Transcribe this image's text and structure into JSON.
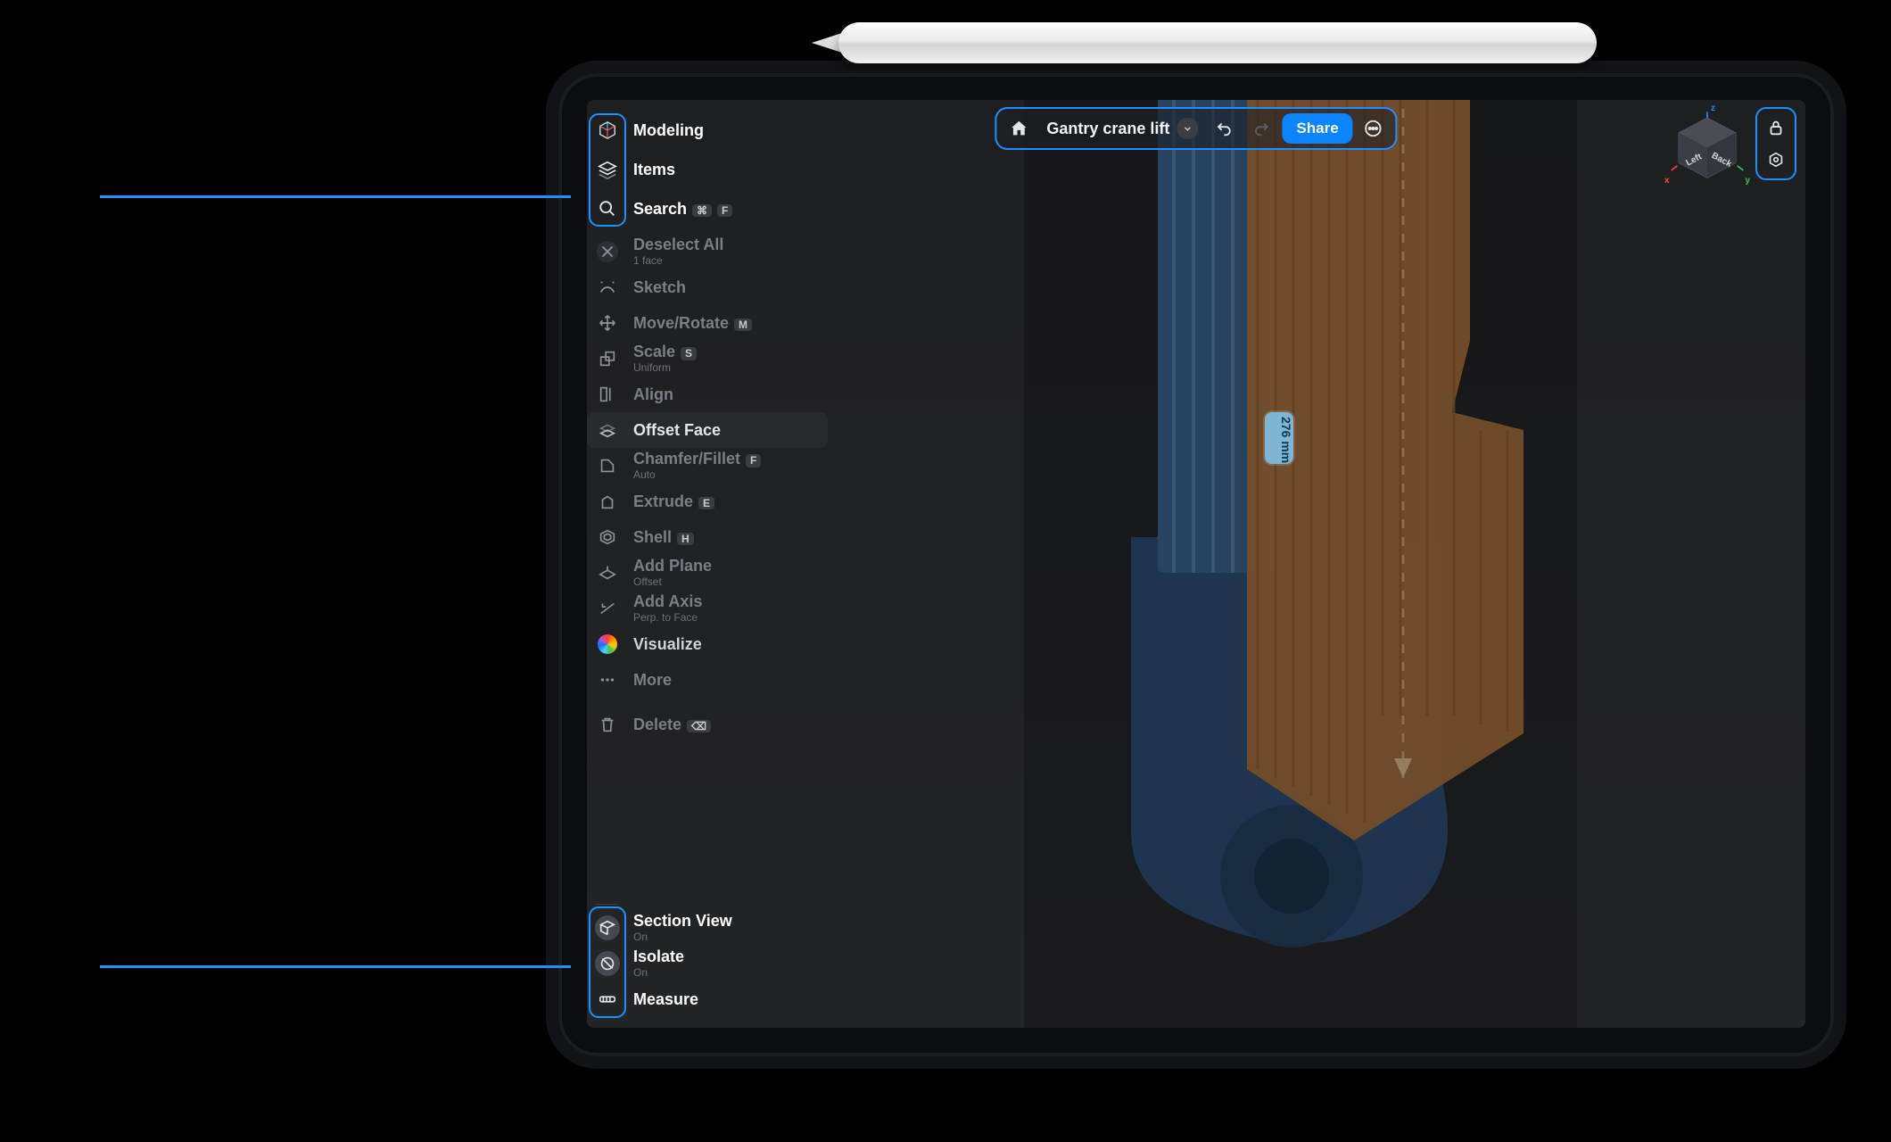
{
  "header": {
    "doc_title": "Gantry crane lift",
    "share_label": "Share"
  },
  "sidebar_top": {
    "modeling": "Modeling",
    "items": "Items",
    "search": "Search",
    "search_k1": "⌘",
    "search_k2": "F"
  },
  "tools": {
    "deselect": {
      "label": "Deselect All",
      "sub": "1 face"
    },
    "sketch": {
      "label": "Sketch"
    },
    "move": {
      "label": "Move/Rotate",
      "k": "M"
    },
    "scale": {
      "label": "Scale",
      "k": "S",
      "sub": "Uniform"
    },
    "align": {
      "label": "Align"
    },
    "offset": {
      "label": "Offset Face"
    },
    "chamfer": {
      "label": "Chamfer/Fillet",
      "k": "F",
      "sub": "Auto"
    },
    "extrude": {
      "label": "Extrude",
      "k": "E"
    },
    "shell": {
      "label": "Shell",
      "k": "H"
    },
    "addplane": {
      "label": "Add Plane",
      "sub": "Offset"
    },
    "addaxis": {
      "label": "Add Axis",
      "sub": "Perp. to Face"
    },
    "visualize": {
      "label": "Visualize"
    },
    "more": {
      "label": "More"
    },
    "delete": {
      "label": "Delete",
      "k": "⌫"
    }
  },
  "sidebar_bottom": {
    "section": {
      "label": "Section View",
      "sub": "On"
    },
    "isolate": {
      "label": "Isolate",
      "sub": "On"
    },
    "measure": {
      "label": "Measure"
    }
  },
  "navcube": {
    "left": "Left",
    "back": "Back",
    "axis_z": "z",
    "axis_y": "y",
    "axis_x": "x"
  },
  "viewport": {
    "measurement": "276 mm"
  },
  "colors": {
    "accent": "#1e90ff",
    "share": "#0a84ff",
    "model_blue": "#2d5b8f",
    "model_wood": "#c4813d"
  }
}
